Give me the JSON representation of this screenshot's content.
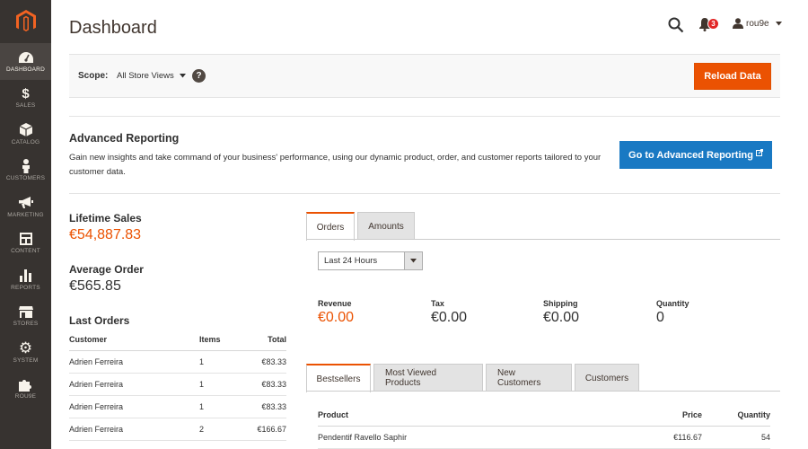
{
  "sidebar": {
    "items": [
      {
        "label": "DASHBOARD",
        "icon": "dashboard-icon",
        "active": true
      },
      {
        "label": "SALES",
        "icon": "dollar-icon"
      },
      {
        "label": "CATALOG",
        "icon": "box-icon"
      },
      {
        "label": "CUSTOMERS",
        "icon": "person-icon"
      },
      {
        "label": "MARKETING",
        "icon": "megaphone-icon"
      },
      {
        "label": "CONTENT",
        "icon": "layout-icon"
      },
      {
        "label": "REPORTS",
        "icon": "bar-chart-icon"
      },
      {
        "label": "STORES",
        "icon": "store-icon"
      },
      {
        "label": "SYSTEM",
        "icon": "gear-icon"
      },
      {
        "label": "ROU9E",
        "icon": "puzzle-icon"
      }
    ]
  },
  "header": {
    "title": "Dashboard",
    "notifications_count": "3",
    "user_name": "rou9e"
  },
  "scope": {
    "label": "Scope:",
    "value": "All Store Views",
    "help": "?",
    "reload_label": "Reload Data"
  },
  "advanced_reporting": {
    "title": "Advanced Reporting",
    "text": "Gain new insights and take command of your business' performance, using our dynamic product, order, and customer reports tailored to your customer data.",
    "button_label": "Go to Advanced Reporting"
  },
  "stats": {
    "lifetime_sales_label": "Lifetime Sales",
    "lifetime_sales_value": "€54,887.83",
    "average_order_label": "Average Order",
    "average_order_value": "€565.85"
  },
  "last_orders": {
    "title": "Last Orders",
    "columns": [
      "Customer",
      "Items",
      "Total"
    ],
    "rows": [
      {
        "customer": "Adrien Ferreira",
        "items": "1",
        "total": "€83.33"
      },
      {
        "customer": "Adrien Ferreira",
        "items": "1",
        "total": "€83.33"
      },
      {
        "customer": "Adrien Ferreira",
        "items": "1",
        "total": "€83.33"
      },
      {
        "customer": "Adrien Ferreira",
        "items": "2",
        "total": "€166.67"
      }
    ]
  },
  "chart_tabs": {
    "tabs": [
      "Orders",
      "Amounts"
    ],
    "active": 0,
    "period": "Last 24 Hours"
  },
  "totals": {
    "revenue_label": "Revenue",
    "revenue_value": "€0.00",
    "tax_label": "Tax",
    "tax_value": "€0.00",
    "shipping_label": "Shipping",
    "shipping_value": "€0.00",
    "quantity_label": "Quantity",
    "quantity_value": "0"
  },
  "grid_tabs": {
    "tabs": [
      "Bestsellers",
      "Most Viewed Products",
      "New Customers",
      "Customers"
    ],
    "active": 0
  },
  "bestsellers": {
    "columns": [
      "Product",
      "Price",
      "Quantity"
    ],
    "rows": [
      {
        "product": "Pendentif Ravello Saphir",
        "price": "€116.67",
        "quantity": "54"
      }
    ]
  },
  "colors": {
    "sidebar_bg": "#373330",
    "accent_orange": "#eb5202",
    "primary_blue": "#1979c3",
    "logo_orange": "#f26322"
  }
}
